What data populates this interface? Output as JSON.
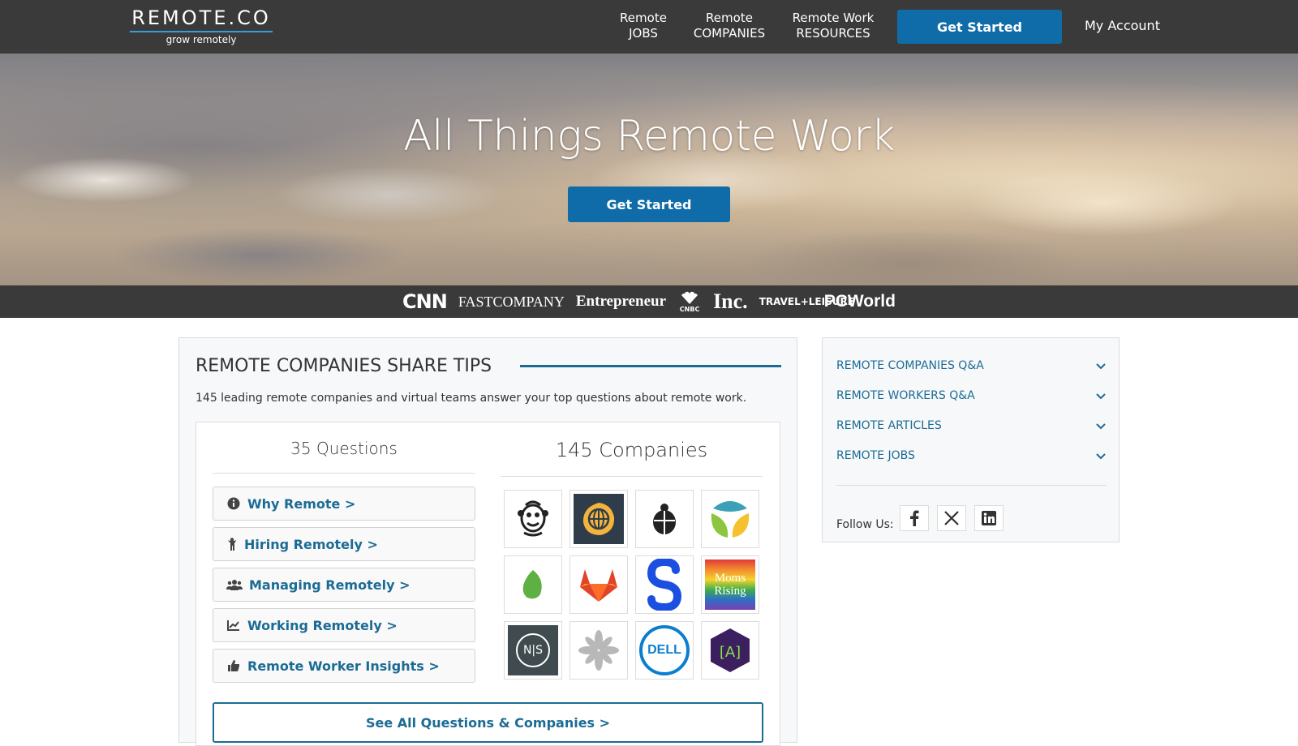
{
  "header": {
    "logo_main": "REMOTE.CO",
    "logo_tagline": "grow remotely",
    "nav": [
      {
        "line1": "Remote",
        "line2": "JOBS"
      },
      {
        "line1": "Remote",
        "line2": "COMPANIES"
      },
      {
        "line1": "Remote Work",
        "line2": "RESOURCES"
      }
    ],
    "get_started": "Get Started",
    "my_account": "My Account"
  },
  "hero": {
    "title": "All Things Remote Work",
    "button": "Get Started"
  },
  "press": [
    "CNN",
    "FASTCOMPANY",
    "Entrepreneur",
    "CNBC",
    "Inc.",
    "TRAVEL+LEISURE",
    "PCWorld"
  ],
  "main": {
    "title": "REMOTE COMPANIES SHARE TIPS",
    "description": "145 leading remote companies and virtual teams answer your top questions about remote work.",
    "questions_heading": "35 Questions",
    "companies_heading": "145 Companies",
    "questions": [
      {
        "label": "Why Remote >",
        "icon": "info-icon"
      },
      {
        "label": "Hiring Remotely >",
        "icon": "person-icon"
      },
      {
        "label": "Managing Remotely >",
        "icon": "users-icon"
      },
      {
        "label": "Working Remotely >",
        "icon": "chart-line-icon"
      },
      {
        "label": "Remote Worker Insights >",
        "icon": "thumbs-up-icon"
      }
    ],
    "companies": [
      {
        "name": "mailchimp-logo"
      },
      {
        "name": "globe-logo"
      },
      {
        "name": "ladybug-logo"
      },
      {
        "name": "petal-logo"
      },
      {
        "name": "evernote-leaf-logo"
      },
      {
        "name": "gitlab-logo"
      },
      {
        "name": "s-logo"
      },
      {
        "name": "momsrising-logo",
        "text_line1": "Moms",
        "text_line2": "Rising"
      },
      {
        "name": "ns-logo",
        "text": "N|S"
      },
      {
        "name": "flower-logo"
      },
      {
        "name": "dell-logo",
        "text": "DELL"
      },
      {
        "name": "a-logo",
        "text": "[A]"
      }
    ],
    "see_all": "See All Questions & Companies >"
  },
  "sidebar": {
    "items": [
      {
        "label": "REMOTE COMPANIES Q&A"
      },
      {
        "label": "REMOTE WORKERS Q&A"
      },
      {
        "label": "REMOTE ARTICLES"
      },
      {
        "label": "REMOTE JOBS"
      }
    ],
    "follow_label": "Follow Us:",
    "social": [
      "facebook-icon",
      "x-icon",
      "linkedin-icon"
    ]
  },
  "colors": {
    "header_bg": "#3a3a3a",
    "accent_blue": "#0f6ca8",
    "link_blue": "#1c6b94"
  }
}
